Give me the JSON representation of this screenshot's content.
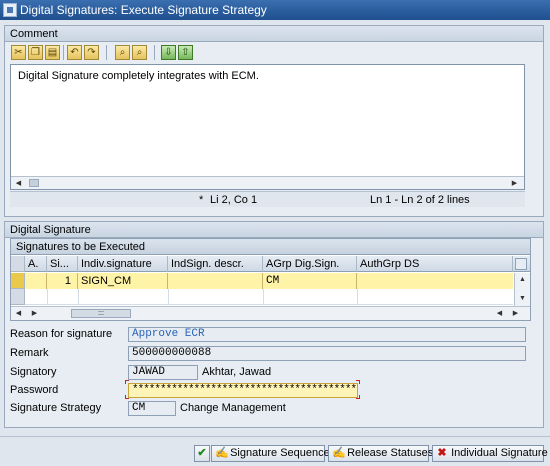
{
  "window": {
    "title": "Digital Signatures: Execute Signature Strategy"
  },
  "comment": {
    "title": "Comment",
    "toolbar": [
      "cut-icon",
      "copy-icon",
      "paste-icon",
      "undo-icon",
      "redo-icon",
      "find-icon",
      "find-next-icon",
      "import-icon",
      "export-icon"
    ],
    "text": "Digital Signature completely integrates with ECM.",
    "status_marker": "*",
    "cursor_pos": "Li 2, Co 1",
    "line_info": "Ln 1 - Ln 2 of 2 lines"
  },
  "digital_signature": {
    "title": "Digital Signature",
    "table": {
      "title": "Signatures to be Executed",
      "columns": [
        "A.",
        "Si...",
        "Indiv.signature",
        "IndSign. descr.",
        "AGrp Dig.Sign.",
        "AuthGrp DS"
      ],
      "rows": [
        {
          "a": "",
          "si": "1",
          "indiv": "SIGN_CM",
          "descr": "",
          "agrp": "CM",
          "auth": ""
        }
      ]
    },
    "form": {
      "reason_label": "Reason for signature",
      "reason_value": "Approve ECR",
      "remark_label": "Remark",
      "remark_value": "500000000088",
      "signatory_label": "Signatory",
      "signatory_value": "JAWAD",
      "signatory_name": "Akhtar, Jawad",
      "password_label": "Password",
      "password_value": "****************************************",
      "strategy_label": "Signature Strategy",
      "strategy_value": "CM",
      "strategy_name": "Change Management"
    }
  },
  "buttons": {
    "signature_sequence": "Signature Sequence",
    "release_statuses": "Release Statuses",
    "individual_signature": "Individual Signature"
  },
  "colors": {
    "titlebar": "#1f4f8f",
    "selected_row": "#fff3a8",
    "blue_value": "#2a64b8",
    "ok_green": "#1f8a1f",
    "cancel_red": "#c01818"
  }
}
